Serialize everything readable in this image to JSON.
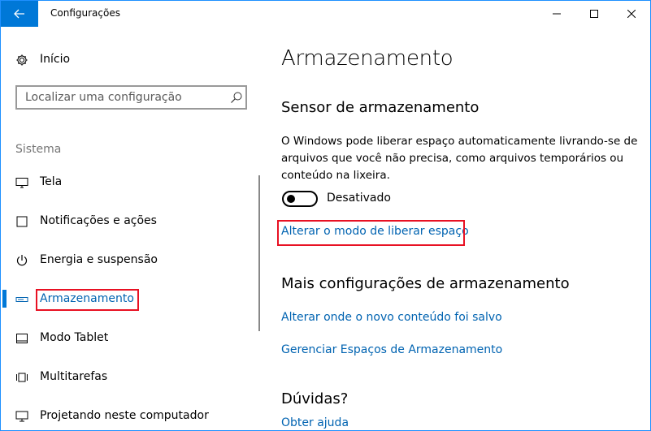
{
  "window": {
    "title": "Configurações"
  },
  "sidebar": {
    "home_label": "Início",
    "search": {
      "placeholder": "Localizar uma configuração"
    },
    "section_label": "Sistema",
    "items": [
      {
        "label": "Tela",
        "icon": "monitor-icon"
      },
      {
        "label": "Notificações e ações",
        "icon": "notifications-icon"
      },
      {
        "label": "Energia e suspensão",
        "icon": "power-icon"
      },
      {
        "label": "Armazenamento",
        "icon": "storage-icon",
        "active": true
      },
      {
        "label": "Modo Tablet",
        "icon": "tablet-icon"
      },
      {
        "label": "Multitarefas",
        "icon": "multitask-icon"
      },
      {
        "label": "Projetando neste computador",
        "icon": "projecting-icon"
      }
    ]
  },
  "main": {
    "title": "Armazenamento",
    "storage_sense": {
      "heading": "Sensor de armazenamento",
      "description": "O Windows pode liberar espaço automaticamente livrando-se de arquivos que você não precisa, como arquivos temporários ou conteúdo na lixeira.",
      "toggle_label": "Desativado",
      "toggle_on": false,
      "change_link": "Alterar o modo de liberar espaço"
    },
    "more_settings": {
      "heading": "Mais configurações de armazenamento",
      "links": [
        "Alterar onde o novo conteúdo foi salvo",
        "Gerenciar Espaços de Armazenamento"
      ]
    },
    "questions": {
      "heading": "Dúvidas?",
      "help_link": "Obter ajuda"
    }
  },
  "colors": {
    "accent": "#0078d7",
    "link": "#0063b1",
    "highlight": "#e81123"
  }
}
